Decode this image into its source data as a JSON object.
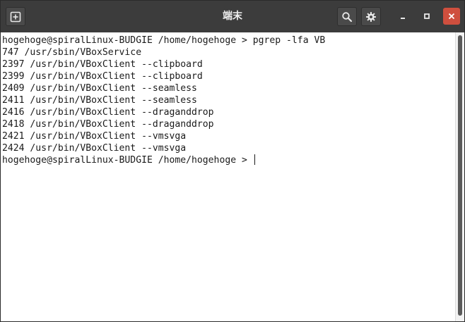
{
  "window": {
    "title": "端末",
    "icons": {
      "new_tab": "new-tab-icon",
      "search": "search-icon",
      "settings": "gear-icon",
      "minimize": "minimize-icon",
      "maximize": "maximize-icon",
      "close": "close-icon"
    },
    "colors": {
      "titlebar": "#3c3c3c",
      "close_button": "#cf4f3e",
      "terminal_bg": "#ffffff",
      "terminal_fg": "#1a1a1a"
    }
  },
  "terminal": {
    "lines": [
      "hogehoge@spiralLinux-BUDGIE /home/hogehoge > pgrep -lfa VB",
      "747 /usr/sbin/VBoxService",
      "2397 /usr/bin/VBoxClient --clipboard",
      "2399 /usr/bin/VBoxClient --clipboard",
      "2409 /usr/bin/VBoxClient --seamless",
      "2411 /usr/bin/VBoxClient --seamless",
      "2416 /usr/bin/VBoxClient --draganddrop",
      "2418 /usr/bin/VBoxClient --draganddrop",
      "2421 /usr/bin/VBoxClient --vmsvga",
      "2424 /usr/bin/VBoxClient --vmsvga"
    ],
    "prompt": "hogehoge@spiralLinux-BUDGIE /home/hogehoge > "
  }
}
